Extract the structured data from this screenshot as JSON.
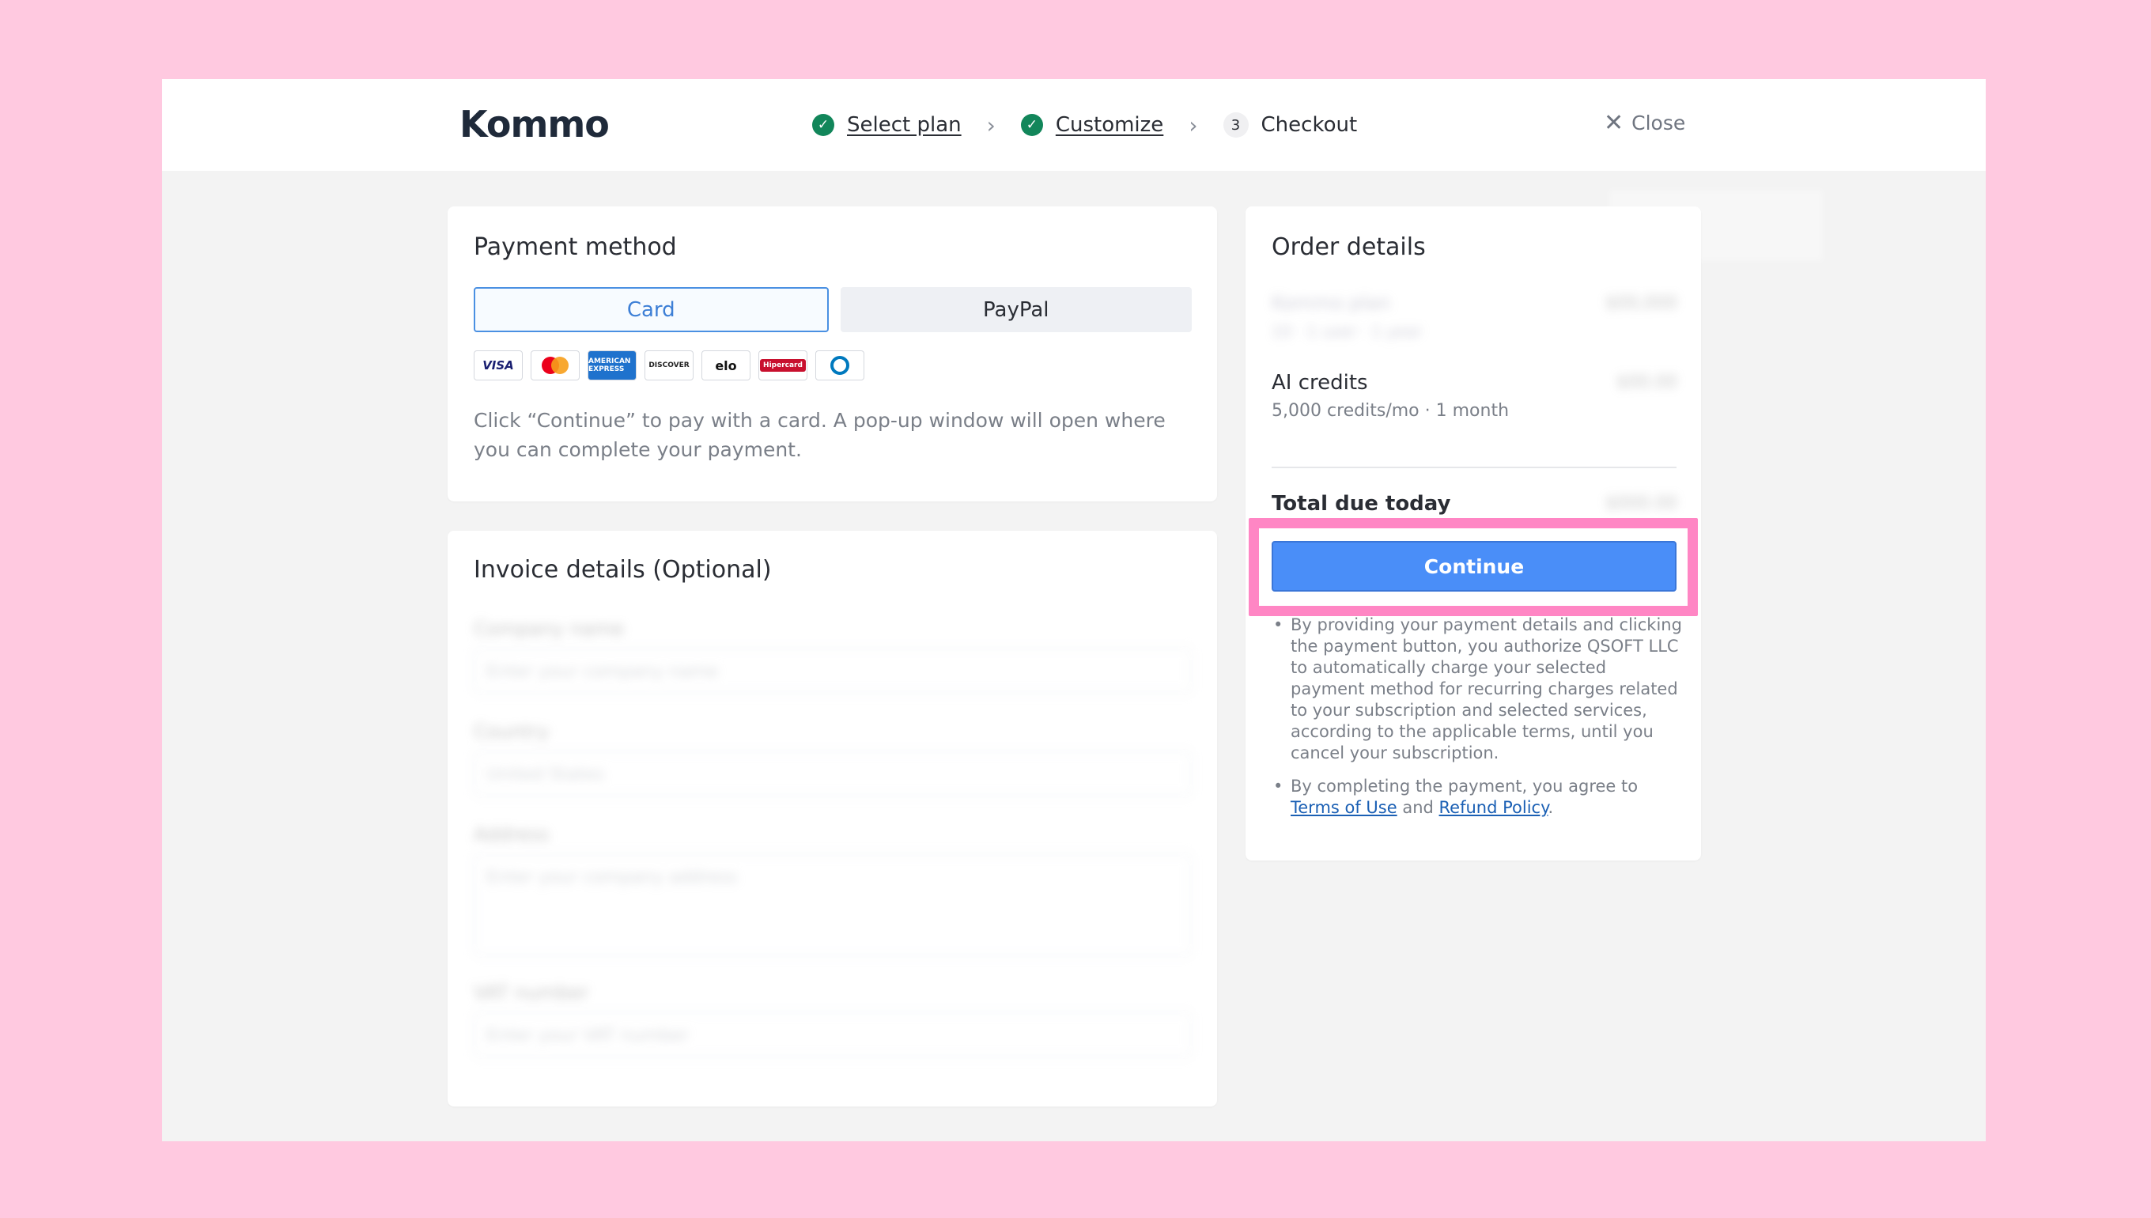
{
  "header": {
    "logo": "Kommo",
    "steps": [
      {
        "label": "Select plan",
        "status": "done"
      },
      {
        "label": "Customize",
        "status": "done"
      },
      {
        "label": "Checkout",
        "status": "current",
        "number": "3"
      }
    ],
    "close_label": "Close"
  },
  "payment": {
    "title": "Payment method",
    "tabs": [
      {
        "label": "Card",
        "active": true
      },
      {
        "label": "PayPal",
        "active": false
      }
    ],
    "brands": [
      "VISA",
      "mastercard",
      "AMERICAN EXPRESS",
      "DISCOVER",
      "elo",
      "Hipercard",
      "Diners Club"
    ],
    "note": "Click “Continue” to pay with a card. A pop-up window will open where you can complete your payment."
  },
  "invoice": {
    "title": "Invoice details (Optional)",
    "fields": [
      {
        "label": "Company name",
        "placeholder": "Enter your company name"
      },
      {
        "label": "Country",
        "placeholder": "United States"
      },
      {
        "label": "Address",
        "placeholder": "Enter your company address"
      },
      {
        "label": "VAT number",
        "placeholder": "Enter your VAT number"
      }
    ]
  },
  "order": {
    "title": "Order details",
    "plan_line": "Kommo plan",
    "plan_sub": "10 · 1 user · 1 year",
    "plan_amount": "$00,000",
    "item": "AI credits",
    "item_sub": "5,000 credits/mo · 1 month",
    "item_amount": "$00.00",
    "total_label": "Total due today",
    "total_amount": "$000.00",
    "continue_label": "Continue",
    "legal_1": "By providing your payment details and clicking the payment button, you authorize QSOFT LLC to automatically charge your selected payment method for recurring charges related to your subscription and selected services, according to the applicable terms, until you cancel your subscription.",
    "legal_2_prefix": "By completing the payment, you agree to ",
    "terms_link": "Terms of Use",
    "and_text": " and ",
    "refund_link": "Refund Policy",
    "period": "."
  },
  "colors": {
    "background": "#ffc9e0",
    "accent": "#4a8ef8",
    "highlight": "#ff86c4",
    "check": "#12865a"
  }
}
